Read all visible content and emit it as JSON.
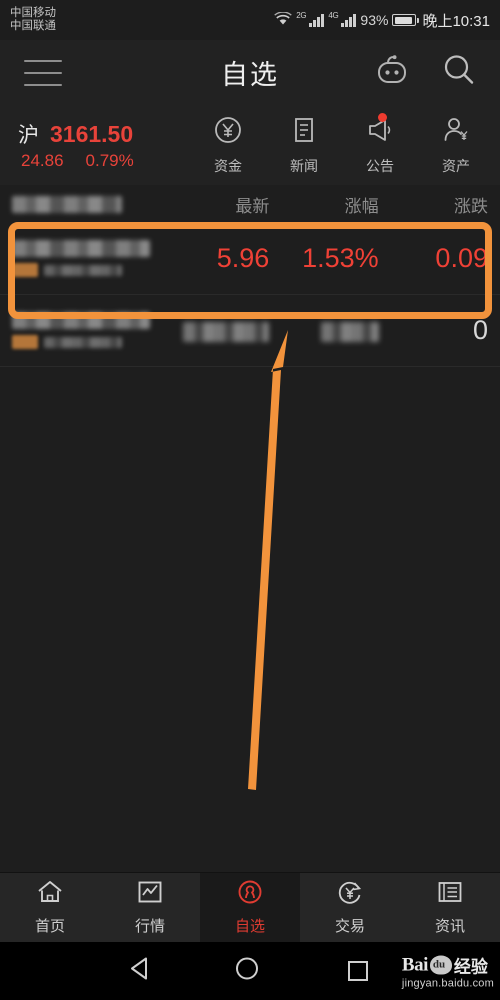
{
  "status_bar": {
    "carrier_primary": "中国移动",
    "carrier_secondary": "中国联通",
    "wifi_icon": "wifi-icon",
    "signal_2g_label": "2G",
    "signal_4g_label": "4G",
    "battery_percent": "93%",
    "time": "晚上10:31"
  },
  "header": {
    "menu_icon": "hamburger-menu-icon",
    "title": "自选",
    "assistant_icon": "robot-assistant-icon",
    "search_icon": "search-icon"
  },
  "index": {
    "name": "沪",
    "value": "3161.50",
    "change": "24.86",
    "change_percent": "0.79%",
    "color": "#e8433a"
  },
  "quick_actions": [
    {
      "label": "资金",
      "icon": "yen-circle-icon",
      "badge": false
    },
    {
      "label": "新闻",
      "icon": "document-icon",
      "badge": false
    },
    {
      "label": "公告",
      "icon": "megaphone-icon",
      "badge": true
    },
    {
      "label": "资产",
      "icon": "person-yen-icon",
      "badge": false
    }
  ],
  "watchlist": {
    "columns": [
      "",
      "最新",
      "涨幅",
      "涨跌"
    ],
    "rows": [
      {
        "name": "",
        "code": "",
        "last": "5.96",
        "change_percent": "1.53%",
        "change": "0.09",
        "highlighted": true,
        "obscured_name": true
      },
      {
        "name": "",
        "code": "",
        "last": "",
        "change_percent": "",
        "change": "0",
        "highlighted": false,
        "obscured_name": true
      }
    ]
  },
  "annotation": {
    "box_color": "#f2933c",
    "arrow_color": "#f2933c",
    "arrow_points_to": "highlighted-watchlist-row"
  },
  "tab_bar": {
    "active": "自选",
    "tabs": [
      {
        "label": "首页",
        "icon": "home-icon"
      },
      {
        "label": "行情",
        "icon": "chart-icon"
      },
      {
        "label": "自选",
        "icon": "watchlist-icon"
      },
      {
        "label": "交易",
        "icon": "trade-yen-icon"
      },
      {
        "label": "资讯",
        "icon": "news-icon"
      }
    ],
    "active_color": "#e03c32"
  },
  "android_nav": {
    "back_icon": "back-triangle-icon",
    "home_icon": "home-circle-icon",
    "recents_icon": "recents-square-icon"
  },
  "watermark": {
    "brand": "Bai",
    "paw_text": "du",
    "suffix": "经验",
    "url": "jingyan.baidu.com"
  }
}
